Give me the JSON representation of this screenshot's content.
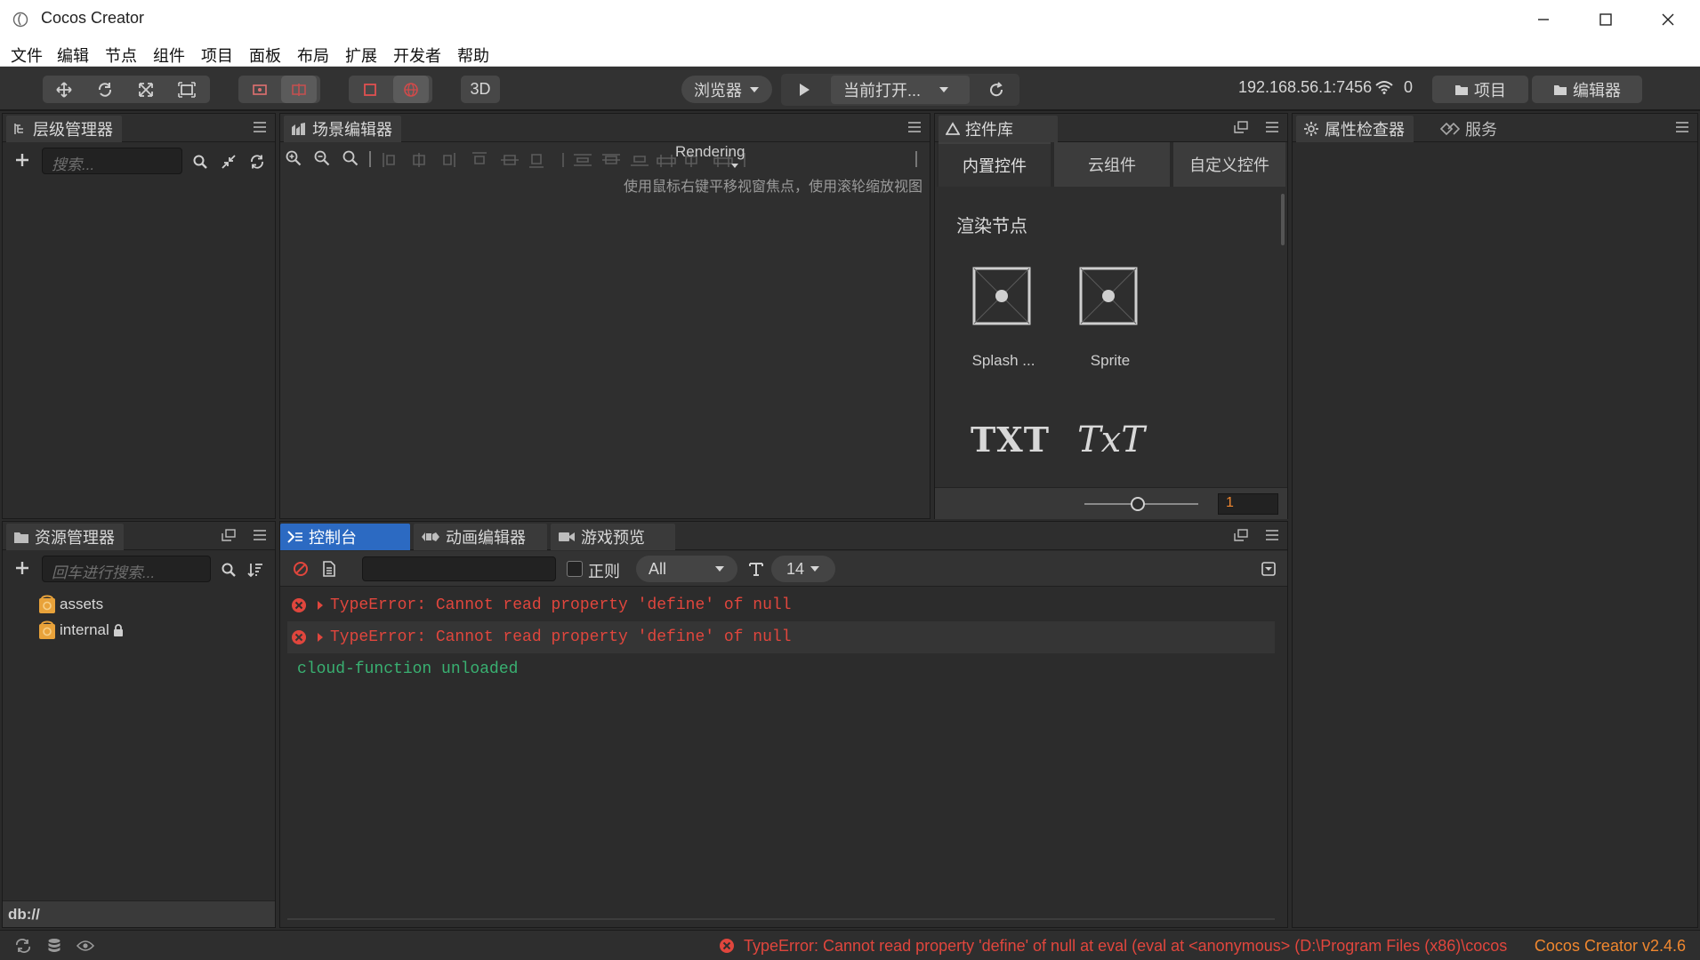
{
  "window": {
    "title": "Cocos Creator"
  },
  "menu": [
    "文件",
    "编辑",
    "节点",
    "组件",
    "项目",
    "面板",
    "布局",
    "扩展",
    "开发者",
    "帮助"
  ],
  "toolbar": {
    "mode_3d": "3D",
    "browser_label": "浏览器",
    "scene_select": "当前打开...",
    "ip_address": "192.168.56.1:7456",
    "client_count": "0",
    "project_btn": "项目",
    "editor_btn": "编辑器"
  },
  "hierarchy": {
    "tab": "层级管理器",
    "search_placeholder": "搜索..."
  },
  "scene": {
    "tab": "场景编辑器",
    "rendering_label": "Rendering",
    "hint": "使用鼠标右键平移视窗焦点，使用滚轮缩放视图"
  },
  "widgets": {
    "tab": "控件库",
    "tabs": [
      "内置控件",
      "云组件",
      "自定义控件"
    ],
    "section_title": "渲染节点",
    "items": [
      {
        "label": "Splash ..."
      },
      {
        "label": "Sprite"
      }
    ],
    "text_items": [
      "TXT",
      "TxT"
    ],
    "scale_value": "1"
  },
  "inspector": {
    "tabs": [
      "属性检查器",
      "服务"
    ]
  },
  "assets": {
    "tab": "资源管理器",
    "search_placeholder": "回车进行搜索...",
    "tree": [
      {
        "name": "assets"
      },
      {
        "name": "internal",
        "locked": true
      }
    ],
    "footer_path": "db://"
  },
  "console": {
    "tabs": [
      "控制台",
      "动画编辑器",
      "游戏预览"
    ],
    "regex_label": "正则",
    "filter_level": "All",
    "font_size": "14",
    "logs": [
      {
        "type": "error",
        "text": "TypeError: Cannot read property 'define' of null"
      },
      {
        "type": "error",
        "text": "TypeError: Cannot read property 'define' of null"
      },
      {
        "type": "info",
        "text": "cloud-function unloaded"
      }
    ]
  },
  "statusbar": {
    "error_text": "TypeError: Cannot read property 'define' of null at eval (eval at <anonymous> (D:\\Program Files (x86)\\cocos",
    "version": "Cocos Creator v2.4.6"
  },
  "colors": {
    "accent_blue": "#2c6ac2",
    "error_red": "#e0463d",
    "info_green": "#39b071",
    "version_orange": "#f0872f"
  }
}
